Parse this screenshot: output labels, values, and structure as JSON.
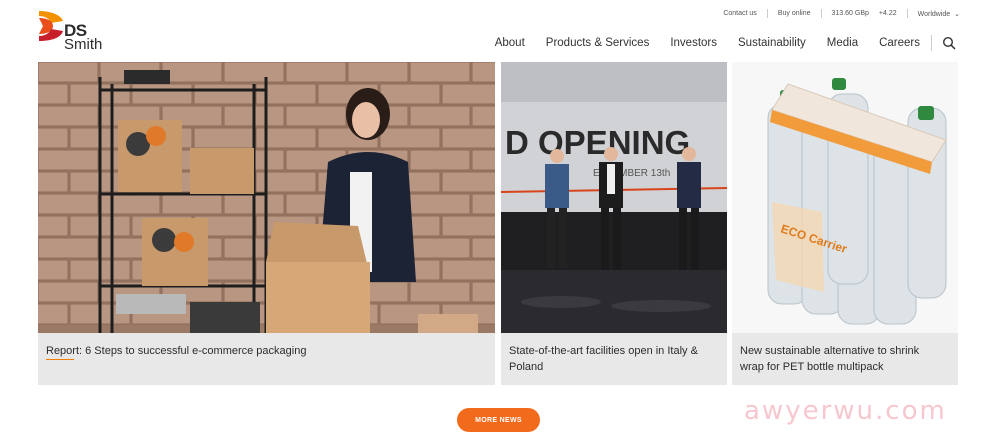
{
  "utility": {
    "contact": "Contact us",
    "buy": "Buy online",
    "price": "313.60 GBp",
    "change": "+4.22",
    "region": "Worldwide"
  },
  "logo": {
    "line1": "DS",
    "line2": "Smith"
  },
  "nav": {
    "items": [
      "About",
      "Products & Services",
      "Investors",
      "Sustainability",
      "Media",
      "Careers"
    ]
  },
  "cards": [
    {
      "caption": "Report: 6 Steps to successful e-commerce packaging"
    },
    {
      "caption": "State-of-the-art facilities open in Italy & Poland",
      "banner": "D OPENING",
      "banner_sub": "EPTEMBER 13th"
    },
    {
      "caption": "New sustainable alternative to shrink wrap for PET bottle multipack",
      "product_label": "ECO Carrier"
    }
  ],
  "more_news": "MORE NEWS",
  "watermark": "awyerwu.com",
  "colors": {
    "accent": "#f26a1b",
    "card_bg": "#e8e8e8"
  }
}
